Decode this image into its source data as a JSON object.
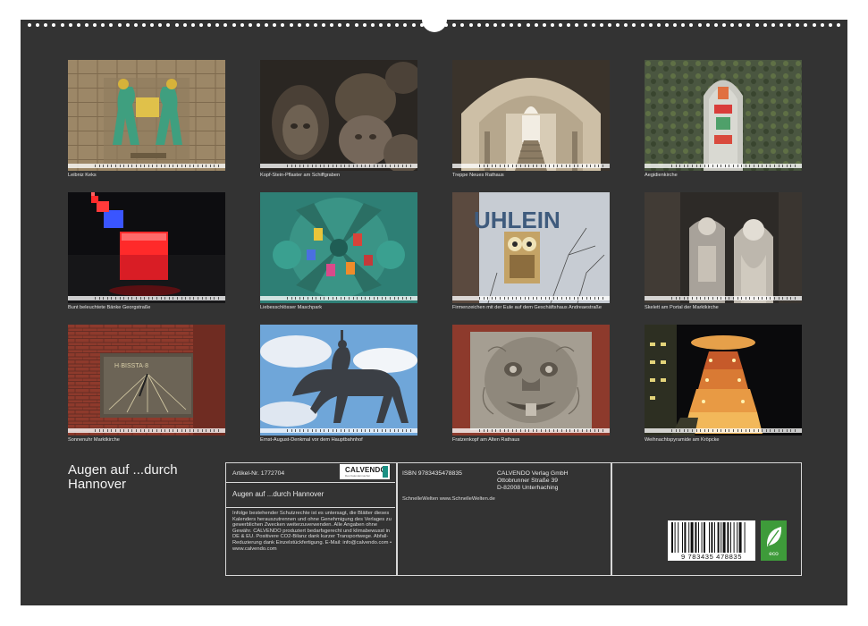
{
  "captions": [
    "Leibniz Keks",
    "Kopf-Stein-Pflaster am Schiffgraben",
    "Treppe Neues Rathaus",
    "Aegidienkirche",
    "Bunt beleuchtete Bänke Georgstraße",
    "Liebesschlösser Maschpark",
    "Firmenzeichen mit der Eule auf dem Geschäftshaus Andreaestraße",
    "Skelett am Portal der Marktkirche",
    "Sonnenuhr Marktkirche",
    "Ernst-August-Denkmal vor dem Hauptbahnhof",
    "Fratzenkopf am Alten Rathaus",
    "Weihnachtspyramide am Kröpcke"
  ],
  "thumb_labels": {
    "uhlein_sign": "UHLEIN",
    "sundial_text": "H·BISSTA·8"
  },
  "title": "Augen auf ...durch Hannover",
  "product": {
    "article_label": "Artikel-Nr. 1772704",
    "brand": "CALVENDO",
    "brand_sub": "Des Kalendermacher",
    "name": "Augen auf ...durch Hannover",
    "legal": "Infolge bestehender Schutzrechte ist es untersagt, die Blätter dieses Kalenders herauszutrennen und ohne Genehmigung des Verlages zu gewerblichen Zwecken weiterzuverwenden. Alle Angaben ohne Gewähr. CALVENDO produziert bedarfsgerecht und klimabewusst in DE & EU. Positivere CO2-Bilanz dank kurzer Transportwege. Abfall-Reduzierung dank Einzelstückfertigung. E-Mail: info@calvendo.com • www.calvendo.com"
  },
  "publisher": {
    "isbn": "ISBN 9783435478835",
    "name": "CALVENDO Verlag GmbH",
    "street": "Ottobrunner Straße 39",
    "city": "D-82008 Unterhaching",
    "web": "SchnelleWelten www.SchnelleWelten.de"
  },
  "barcode": {
    "number": "9 783435 478835"
  },
  "eco_label": "eco",
  "colors": {
    "background": "#333333",
    "text": "#e6e6e6",
    "eco_green": "#3e9b3a",
    "calvendo_teal": "#1a8f83"
  }
}
